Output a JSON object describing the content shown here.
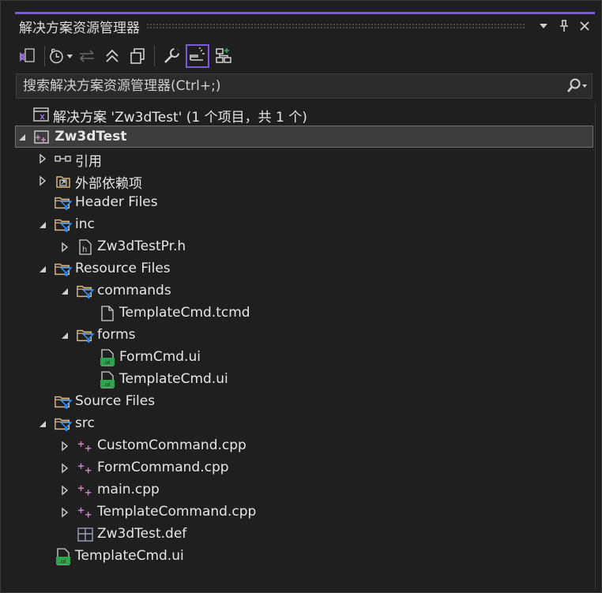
{
  "panel": {
    "title": "解决方案资源管理器",
    "accent_color": "#7c5bd6",
    "title_buttons": [
      {
        "name": "dropdown-arrow-icon"
      },
      {
        "name": "pin-icon"
      },
      {
        "name": "close-icon"
      }
    ]
  },
  "toolbar": {
    "buttons": [
      {
        "name": "switch-views-icon"
      },
      {
        "name": "pending-changes-filter-icon"
      },
      {
        "name": "sync-with-document-icon"
      },
      {
        "name": "collapse-all-icon"
      },
      {
        "name": "show-all-files-icon"
      },
      {
        "name": "properties-wrench-icon"
      },
      {
        "name": "preview-selected-items-icon",
        "active": true
      },
      {
        "name": "class-view-icon"
      }
    ]
  },
  "search": {
    "placeholder": "搜索解决方案资源管理器(Ctrl+;)"
  },
  "tree": {
    "solution_label": "解决方案 'Zw3dTest' (1 个项目，共 1 个)",
    "project_label": "Zw3dTest",
    "nodes": [
      {
        "label": "引用",
        "expander": "collapsed",
        "icon": "references-icon"
      },
      {
        "label": "外部依赖项",
        "expander": "collapsed",
        "icon": "external-dependencies-icon"
      },
      {
        "label": "Header Files",
        "expander": "none",
        "icon": "filter-folder-icon"
      },
      {
        "label": "inc",
        "expander": "expanded",
        "icon": "filter-folder-icon"
      },
      {
        "label": "Zw3dTestPr.h",
        "expander": "collapsed",
        "icon": "header-file-icon"
      },
      {
        "label": "Resource Files",
        "expander": "expanded",
        "icon": "filter-folder-icon"
      },
      {
        "label": "commands",
        "expander": "expanded",
        "icon": "filter-folder-icon"
      },
      {
        "label": "TemplateCmd.tcmd",
        "expander": "none",
        "icon": "generic-file-icon"
      },
      {
        "label": "forms",
        "expander": "expanded",
        "icon": "filter-folder-icon"
      },
      {
        "label": "FormCmd.ui",
        "expander": "none",
        "icon": "ui-file-icon"
      },
      {
        "label": "TemplateCmd.ui",
        "expander": "none",
        "icon": "ui-file-icon"
      },
      {
        "label": "Source Files",
        "expander": "none",
        "icon": "filter-folder-icon"
      },
      {
        "label": "src",
        "expander": "expanded",
        "icon": "filter-folder-icon"
      },
      {
        "label": "CustomCommand.cpp",
        "expander": "collapsed",
        "icon": "cpp-file-icon"
      },
      {
        "label": "FormCommand.cpp",
        "expander": "collapsed",
        "icon": "cpp-file-icon"
      },
      {
        "label": "main.cpp",
        "expander": "collapsed",
        "icon": "cpp-file-icon"
      },
      {
        "label": "TemplateCommand.cpp",
        "expander": "collapsed",
        "icon": "cpp-file-icon"
      },
      {
        "label": "Zw3dTest.def",
        "expander": "none",
        "icon": "def-file-icon"
      },
      {
        "label": "TemplateCmd.ui",
        "expander": "none",
        "icon": "ui-file-icon"
      }
    ],
    "colors": {
      "folder": "#dcb67a",
      "filter": "#3794ff",
      "cpp": "#c586c0",
      "ui_file": "#2da44e",
      "selection": "#3d3d3d"
    }
  }
}
